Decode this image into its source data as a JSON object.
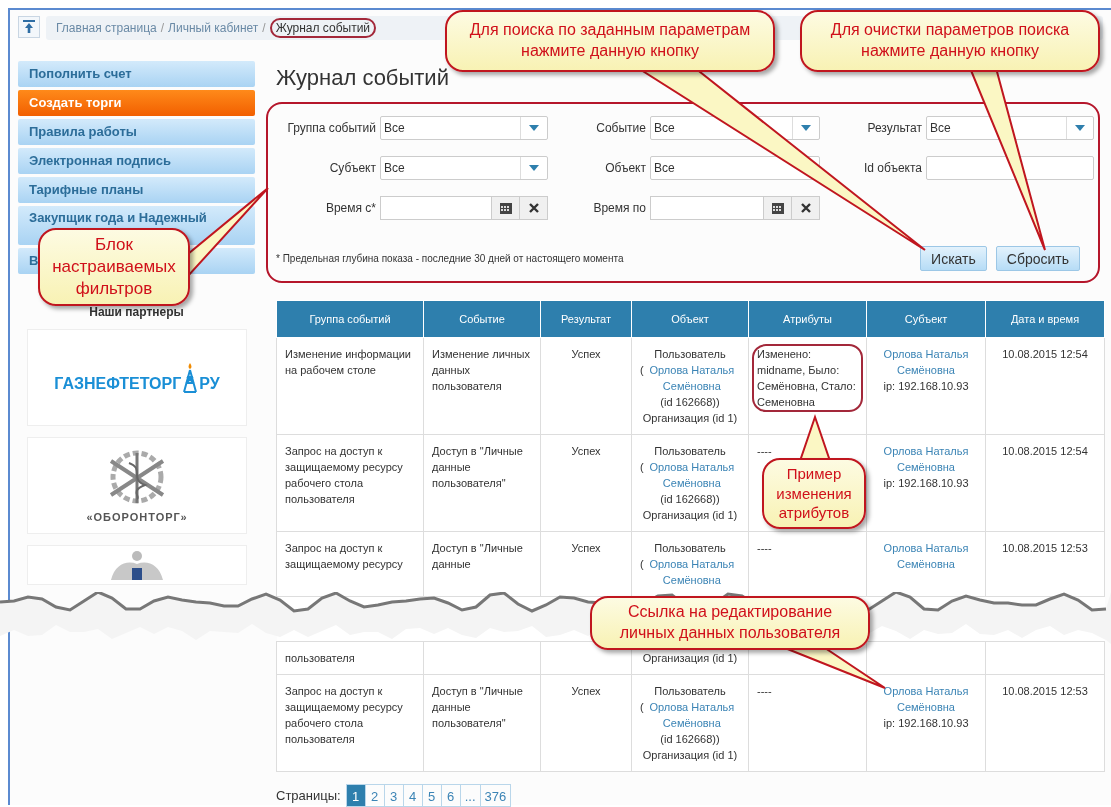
{
  "breadcrumb": [
    {
      "kind": "link",
      "label": "Главная страница",
      "current": false
    },
    {
      "kind": "separator",
      "label": "/"
    },
    {
      "kind": "link",
      "label": "Личный кабинет",
      "current": false
    },
    {
      "kind": "separator",
      "label": "/"
    },
    {
      "kind": "link",
      "label": "Журнал событий",
      "current": true
    }
  ],
  "sidebar": {
    "items": [
      {
        "label": "Пополнить счет",
        "highlighted": false
      },
      {
        "label": "Создать торги",
        "highlighted": true
      },
      {
        "label": "Правила работы",
        "highlighted": false
      },
      {
        "label": "Электронная подпись",
        "highlighted": false
      },
      {
        "label": "Тарифные планы",
        "highlighted": false
      },
      {
        "label": "Закупщик года и Надежный",
        "highlighted": false
      },
      {
        "label": "В",
        "highlighted": false
      }
    ],
    "partners_title": "Наши партнеры",
    "partners": [
      {
        "kind": "oil",
        "text": "ГАЗНЕФТЕТОРГ",
        "suffix": "РУ"
      },
      {
        "kind": "emblem",
        "text": "«ОБОРОНТОРГ»"
      },
      {
        "kind": "eagle"
      }
    ]
  },
  "page_title": "Журнал событий",
  "filters": {
    "fields": [
      {
        "label": "Группа событий",
        "kind": "select",
        "value": "Все"
      },
      {
        "label": "Событие",
        "kind": "select",
        "value": "Все"
      },
      {
        "label": "Результат",
        "kind": "select",
        "value": "Все"
      },
      {
        "label": "Субъект",
        "kind": "select",
        "value": "Все"
      },
      {
        "label": "Объект",
        "kind": "text",
        "value": "Все"
      },
      {
        "label": "Id объекта",
        "kind": "text"
      },
      {
        "label": "Время с*",
        "kind": "date"
      },
      {
        "label": "Время по",
        "kind": "date"
      }
    ],
    "note": "* Предельная глубина показа - последние 30 дней от настоящего момента",
    "buttons": [
      "Искать",
      "Сбросить"
    ]
  },
  "table": {
    "columns": [
      "Группа событий",
      "Событие",
      "Результат",
      "Объект",
      "Атрибуты",
      "Субъект",
      "Дата и время"
    ],
    "rows": [
      {
        "group": "Изменение информации на рабочем столе",
        "event": "Изменение личных данных пользователя",
        "result": "Успех",
        "object": {
          "type": "Пользователь",
          "paren": "(",
          "link": "Орлова Наталья Семёновна",
          "after": "(id 162668)) Организация (id 1)"
        },
        "attributes": "Изменено: midname, Было: Семёновна, Стало: Семеновна",
        "attributes_circled": true,
        "subject": {
          "link": "Орлова Наталья Семёновна",
          "ip": "ip: 192.168.10.93"
        },
        "date": "10.08.2015 12:54"
      },
      {
        "group": "Запрос на доступ к защищаемому ресурсу рабочего стола пользователя",
        "event": "Доступ в \"Личные данные пользователя\"",
        "result": "Успех",
        "object": {
          "type": "Пользователь",
          "paren": "(",
          "link": "Орлова Наталья Семёновна",
          "after": "(id 162668)) Организация (id 1)"
        },
        "attributes": "----",
        "attributes_circled": false,
        "subject": {
          "link": "Орлова Наталья Семёновна",
          "ip": "ip: 192.168.10.93"
        },
        "date": "10.08.2015 12:54"
      },
      {
        "group": "Запрос на доступ к защищаемому ресурсу",
        "event": "Доступ в \"Личные данные",
        "result": "Успех",
        "object": {
          "type": "Пользователь",
          "paren": "(",
          "link": "Орлова Наталья Семёновна"
        },
        "attributes": "----",
        "attributes_circled": false,
        "subject": {
          "link": "Орлова Наталья Семёновна"
        },
        "date": "10.08.2015 12:53"
      },
      {
        "torn_above": true,
        "group": "пользователя",
        "object": {
          "after": "Организация (id 1)"
        }
      },
      {
        "group": "Запрос на доступ к защищаемому ресурсу рабочего стола пользователя",
        "event": "Доступ в \"Личные данные пользователя\"",
        "result": "Успех",
        "object": {
          "type": "Пользователь",
          "paren": "(",
          "link": "Орлова Наталья Семёновна",
          "after": "(id 162668)) Организация (id 1)"
        },
        "attributes": "----",
        "attributes_circled": false,
        "subject": {
          "link": "Орлова Наталья Семёновна",
          "ip": "ip: 192.168.10.93"
        },
        "date": "10.08.2015 12:53"
      }
    ]
  },
  "pagination": {
    "label": "Страницы:",
    "pages": [
      {
        "label": "1",
        "selected": true
      },
      {
        "label": "2",
        "selected": false
      },
      {
        "label": "3",
        "selected": false
      },
      {
        "label": "4",
        "selected": false
      },
      {
        "label": "5",
        "selected": false
      },
      {
        "label": "6",
        "selected": false
      },
      {
        "label": "...",
        "selected": false
      },
      {
        "label": "376",
        "selected": false
      }
    ]
  },
  "callouts": [
    "Для поиска по заданным параметрам нажмите данную кнопку",
    "Для очистки параметров поиска нажмите данную кнопку",
    "Блок настраиваемых фильтров",
    "Пример изменения атрибутов",
    "Ссылка на редактирование личных данных пользователя"
  ]
}
